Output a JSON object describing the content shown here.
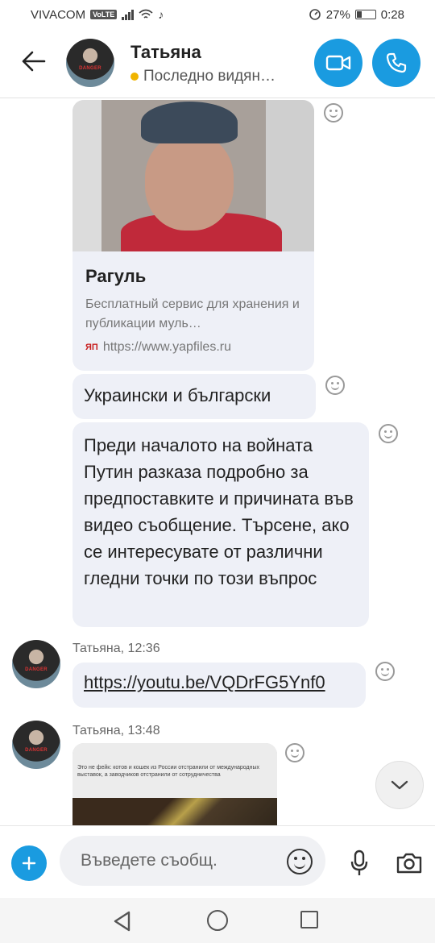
{
  "status_bar": {
    "carrier": "VIVACOM",
    "volte": "VoLTE",
    "battery": "27%",
    "time": "0:28"
  },
  "header": {
    "contact_name": "Татьяна",
    "status": "Последно видян…",
    "avatar_text": "DANGER"
  },
  "messages": {
    "link_card": {
      "title": "Рагуль",
      "description": "Бесплатный сервис для хранения и публикации муль…",
      "site_logo": "ЯП",
      "url": "https://www.yapfiles.ru"
    },
    "lang_text": "Украински и български",
    "long_text": "Преди началото на войната Путин разказа подробно за предпоставките и причината във видео съобщение. Търсене, ако се интересувате от различни гледни точки по този въпрос",
    "sender_1": "Татьяна, 12:36",
    "youtube_link": "https://youtu.be/VQDrFG5Ynf0",
    "sender_2": "Татьяна, 13:48",
    "image_caption": "Это не фейк: котов и кошек из России отстранили от международных выставок, а заводчиков отстранили от сотрудничества"
  },
  "composer": {
    "placeholder": "Въведете съобщ."
  },
  "colors": {
    "accent": "#1a9be0",
    "bubble": "#eef0f7",
    "away_dot": "#f0b400"
  }
}
